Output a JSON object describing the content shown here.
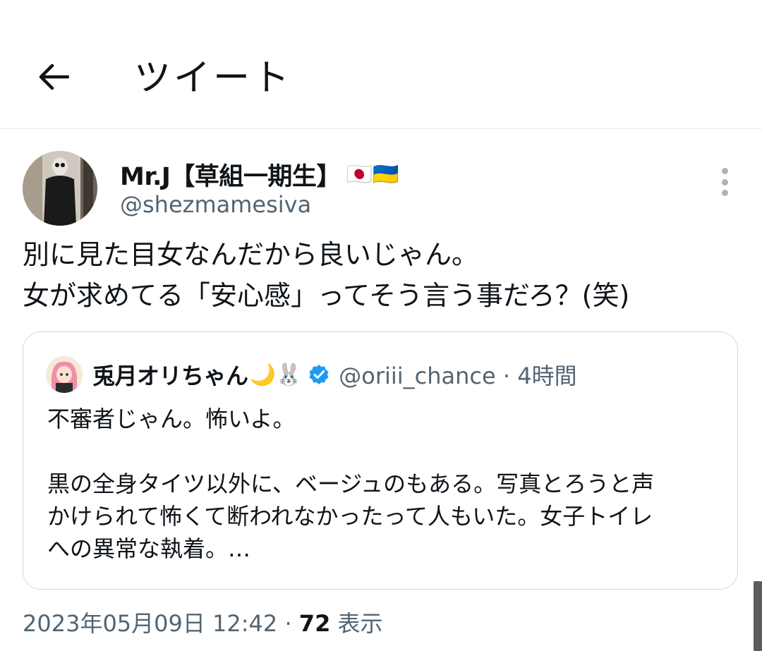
{
  "header": {
    "title": "ツイート",
    "back_icon": "arrow-left-icon"
  },
  "tweet": {
    "author": {
      "display_name": "Mr.J【草組一期生】",
      "flags": "🇯🇵🇺🇦",
      "handle": "@shezmamesiva"
    },
    "text_lines": [
      "別に見た目女なんだから良いじゃん。",
      "女が求めてる「安心感」ってそう言う事だろ？(笑)"
    ],
    "quote": {
      "author": {
        "display_name": "兎月オリちゃん",
        "emojis": "🌙🐰",
        "verified": true,
        "handle": "@oriii_chance · 4時間"
      },
      "text_lines": [
        "不審者じゃん。怖いよ。",
        "",
        "黒の全身タイツ以外に、ベージュのもある。写真とろうと声",
        "かけられて怖くて断われなかったって人もいた。女子トイレ",
        "への異常な執着。…"
      ]
    },
    "timestamp": "2023年05月09日 12:42 · ",
    "view_count": "72",
    "view_label": " 表示"
  },
  "colors": {
    "text": "#0f1419",
    "secondary": "#536471",
    "border": "#cfd9de",
    "verified": "#1d9bf0"
  }
}
